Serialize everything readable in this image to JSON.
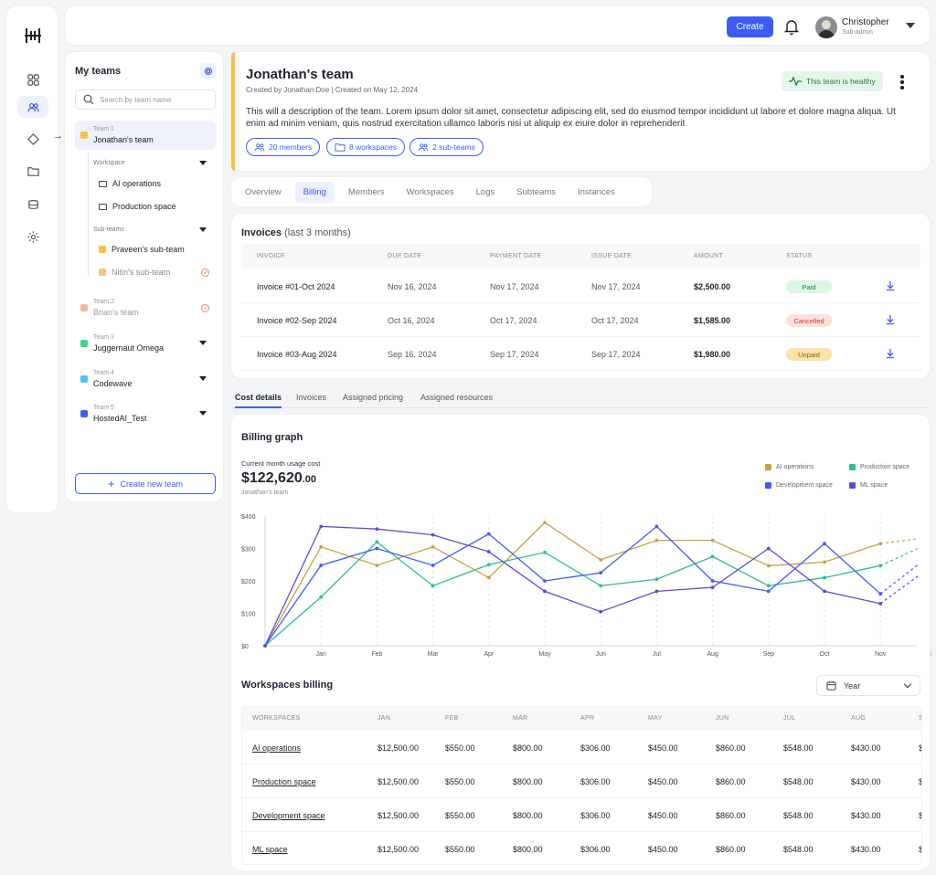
{
  "topbar": {
    "create_label": "Create",
    "user_name": "Christopher",
    "user_role": "Sub-admin"
  },
  "teams_panel": {
    "title": "My teams",
    "search_placeholder": "Search by team name",
    "teams": [
      {
        "num": "Team 1",
        "name": "Jonathan's team",
        "color": "#f6c24a"
      },
      {
        "num": "Team 2",
        "name": "Brian's team",
        "color": "#f5b99a"
      },
      {
        "num": "Team 3",
        "name": "Juggernaut Omega",
        "color": "#3dd68c"
      },
      {
        "num": "Team 4",
        "name": "Codewave",
        "color": "#4fc3f7"
      },
      {
        "num": "Team 5",
        "name": "HostedAI_Test",
        "color": "#3d5cf5"
      }
    ],
    "workspace_label": "Workspace",
    "workspaces": [
      "AI operations",
      "Production space"
    ],
    "subteams_label": "Sub-teams",
    "subteams": [
      "Praveen's sub-team",
      "Nitin's sub-team"
    ],
    "new_team_label": "Create new team"
  },
  "header": {
    "title": "Jonathan's team",
    "created": "Created by Jonathan Doe | Created on May 12, 2024",
    "description": "This will a description of the team. Lorem ipsum dolor sit amet, consectetur adipiscing elit, sed do eiusmod tempor incididunt ut labore et dolore magna aliqua. Ut enim ad minim veniam, quis nostrud exercitation ullamco laboris nisi ut aliquip ex eiure dolor in reprehenderit",
    "health": "This team is healthy",
    "pills": [
      "20 members",
      "8 workspaces",
      "2 sub-teams"
    ]
  },
  "tabs": [
    "Overview",
    "Billing",
    "Members",
    "Workspaces",
    "Logs",
    "Subteams",
    "Instances"
  ],
  "invoices": {
    "title": "Invoices",
    "subtitle": "(last 3 months)",
    "columns": [
      "INVOICE",
      "DUE DATE",
      "PAYMENT DATE",
      "ISSUE DATE",
      "AMOUNT",
      "STATUS"
    ],
    "rows": [
      {
        "invoice": "Invoice #01-Oct 2024",
        "due": "Nov 16, 2024",
        "payment": "Nov 17, 2024",
        "issue": "Nov 17, 2024",
        "amount": "$2,500.00",
        "status": "Paid"
      },
      {
        "invoice": "Invoice #02-Sep 2024",
        "due": "Oct 16, 2024",
        "payment": "Oct 17, 2024",
        "issue": "Oct 17, 2024",
        "amount": "$1,585.00",
        "status": "Cancelled"
      },
      {
        "invoice": "Invoice #03-Aug 2024",
        "due": "Sep 16, 2024",
        "payment": "Sep 17, 2024",
        "issue": "Sep 17, 2024",
        "amount": "$1,980.00",
        "status": "Unpaid"
      }
    ],
    "status_colors": {
      "Paid": [
        "#dcf7e4",
        "#1d7a46"
      ],
      "Cancelled": [
        "#fde0dc",
        "#c0392b"
      ],
      "Unpaid": [
        "#fde3a7",
        "#8a5a00"
      ]
    }
  },
  "subtabs": [
    "Cost details",
    "Invoices",
    "Assigned pricing",
    "Assigned resources"
  ],
  "billing": {
    "title": "Billing graph",
    "usage_label": "Current month usage cost",
    "usage_main": "$122,620",
    "usage_cents": ".00",
    "usage_team": "Jonathan's team"
  },
  "chart_data": {
    "type": "line",
    "categories": [
      "Jan",
      "Feb",
      "Mar",
      "Apr",
      "May",
      "Jun",
      "Jul",
      "Aug",
      "Sep",
      "Oct",
      "Nov",
      "Dec"
    ],
    "y_ticks": [
      "$0",
      "$100",
      "$200",
      "$300",
      "$400"
    ],
    "ylim": [
      0,
      400
    ],
    "start_value": 0,
    "series": [
      {
        "name": "AI operations",
        "color": "#c9a23f",
        "values": [
          305,
          248,
          305,
          210,
          380,
          265,
          325,
          325,
          247,
          258,
          315
        ],
        "projected": 330
      },
      {
        "name": "Production space",
        "color": "#2dbf94",
        "values": [
          150,
          320,
          185,
          250,
          288,
          185,
          205,
          275,
          185,
          210,
          247
        ],
        "projected": 300
      },
      {
        "name": "Development space",
        "color": "#3d5cf5",
        "values": [
          248,
          300,
          248,
          345,
          200,
          225,
          368,
          200,
          168,
          315,
          160
        ],
        "projected": 250
      },
      {
        "name": "ML space",
        "color": "#6a45d8",
        "values": [
          368,
          360,
          342,
          290,
          168,
          105,
          168,
          180,
          300,
          168,
          130
        ],
        "projected": 215
      }
    ],
    "legend_position": "top-right",
    "grid": "vertical dashed"
  },
  "workspaces_billing": {
    "title": "Workspaces billing",
    "period": "Year",
    "columns": [
      "WORKSPACES",
      "JAN",
      "FEB",
      "MAR",
      "APR",
      "MAY",
      "JUN",
      "JUL",
      "AUG",
      "S"
    ],
    "rows": [
      {
        "name": "AI operations",
        "values": [
          "$12,500.00",
          "$550.00",
          "$800.00",
          "$306.00",
          "$450.00",
          "$860.00",
          "$548.00",
          "$430.00",
          "$"
        ]
      },
      {
        "name": "Production space",
        "values": [
          "$12,500.00",
          "$550.00",
          "$800.00",
          "$306.00",
          "$450.00",
          "$860.00",
          "$548.00",
          "$430.00",
          "$"
        ]
      },
      {
        "name": "Development space",
        "values": [
          "$12,500.00",
          "$550.00",
          "$800.00",
          "$306.00",
          "$450.00",
          "$860.00",
          "$548.00",
          "$430.00",
          "$"
        ]
      },
      {
        "name": "ML space",
        "values": [
          "$12,500.00",
          "$550.00",
          "$800.00",
          "$306.00",
          "$450.00",
          "$860.00",
          "$548.00",
          "$430.00",
          "$"
        ]
      }
    ]
  }
}
